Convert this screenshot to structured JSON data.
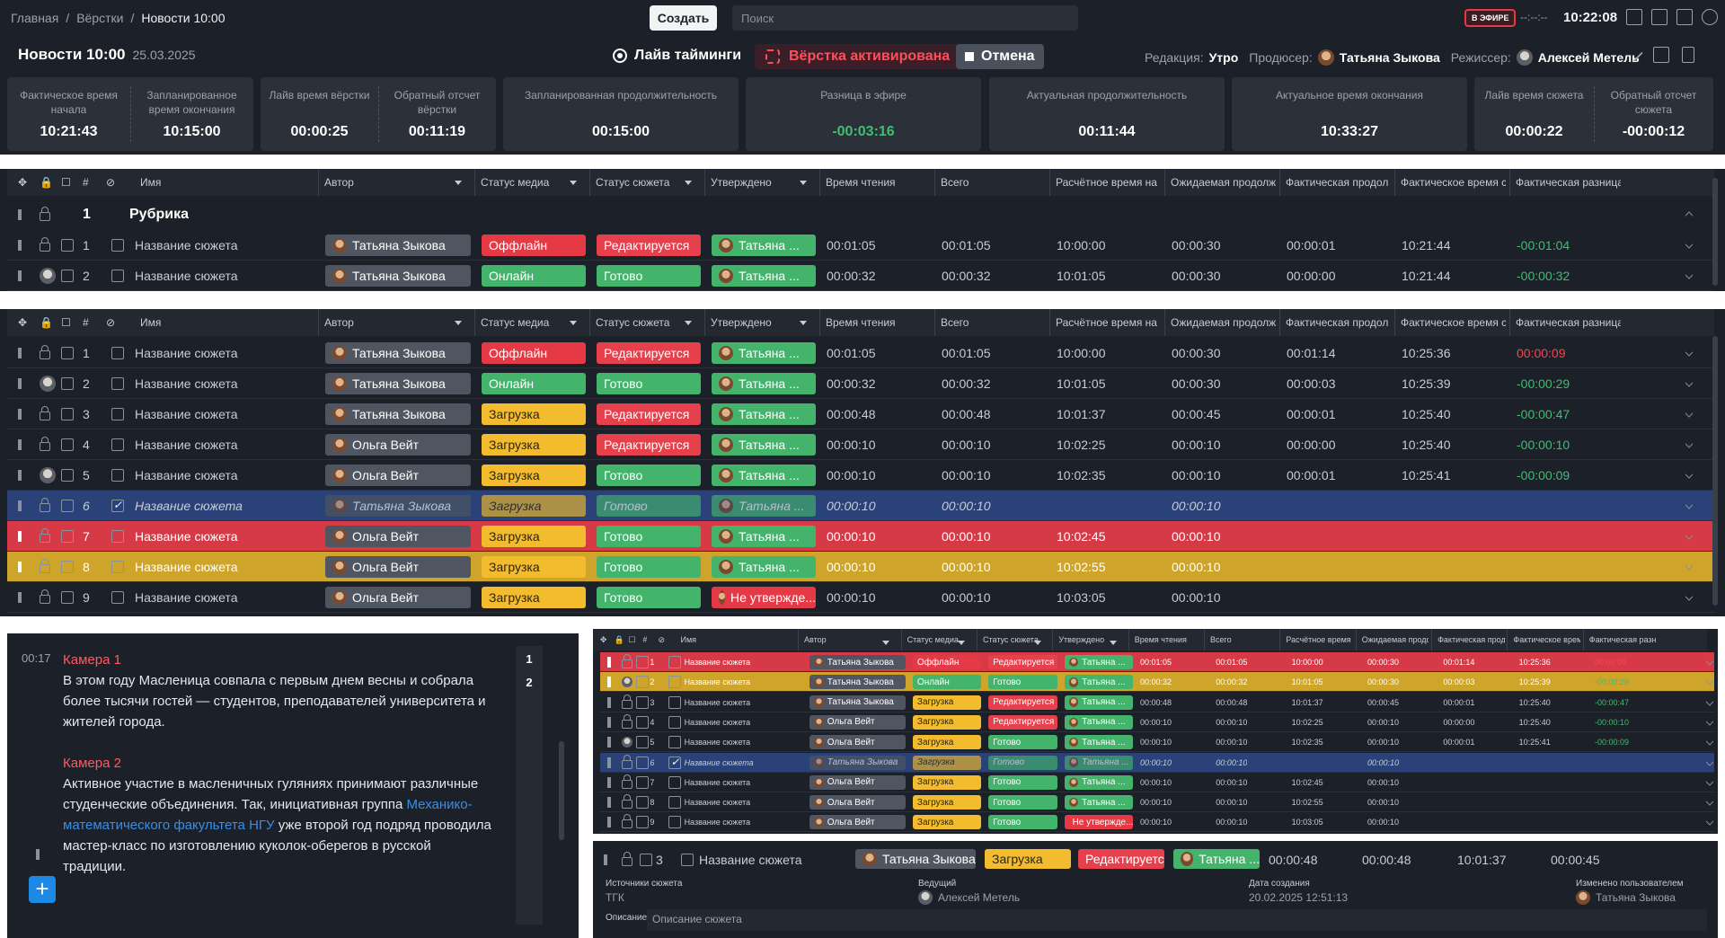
{
  "breadcrumbs": [
    "Главная",
    "Вёрстки",
    "Новости 10:00"
  ],
  "create_label": "Создать",
  "search_placeholder": "Поиск",
  "on_air_badge": "В ЭФИРЕ",
  "air_time": "--:--:--",
  "clock": "10:22:08",
  "rundown": {
    "title": "Новости 10:00",
    "date": "25.03.2025"
  },
  "live_timings_label": "Лайв тайминги",
  "verstka_active_label": "Вёрстка активирована",
  "cancel_label": "Отмена",
  "staff": {
    "redaction_label": "Редакция:",
    "redaction": "Утро",
    "producer_label": "Продюсер:",
    "producer": "Татьяна Зыкова",
    "director_label": "Режиссер:",
    "director": "Алексей Метель"
  },
  "stats": [
    {
      "label": "Фактическое время начала",
      "value": "10:21:43"
    },
    {
      "label": "Запланированное время окончания",
      "value": "10:15:00"
    },
    {
      "label": "Лайв время вёрстки",
      "value": "00:00:25"
    },
    {
      "label": "Обратный отсчет вёрстки",
      "value": "00:11:19"
    },
    {
      "label": "Запланированная продолжительность",
      "value": "00:15:00"
    },
    {
      "label": "Разница в эфире",
      "value": "-00:03:16"
    },
    {
      "label": "Актуальная продолжительность",
      "value": "00:11:44"
    },
    {
      "label": "Актуальное время окончания",
      "value": "10:33:27"
    },
    {
      "label": "Лайв время сюжета",
      "value": "00:00:22"
    },
    {
      "label": "Обратный отсчет сюжета",
      "value": "-00:00:12"
    }
  ],
  "columns": [
    "#",
    "Имя",
    "Автор",
    "Статус медиа",
    "Статус сюжета",
    "Утверждено",
    "Время чтения",
    "Всего",
    "Расчётное время на",
    "Ожидаемая продолж",
    "Фактическая продол",
    "Фактическое время с",
    "Фактическая разница"
  ],
  "rubric": {
    "num": "1",
    "title": "Рубрика"
  },
  "top_rows": [
    {
      "n": "1",
      "name": "Название сюжета",
      "author": "Татьяна Зыкова",
      "media": "Оффлайн",
      "status": "Редактируется",
      "appr": "Татьяна ...",
      "read": "00:01:05",
      "total": "00:01:05",
      "calc": "10:00:00",
      "exp": "00:00:30",
      "fact": "00:00:01",
      "facttime": "10:21:44",
      "diff": "-00:01:04"
    },
    {
      "n": "2",
      "name": "Название сюжета",
      "author": "Татьяна Зыкова",
      "media": "Онлайн",
      "status": "Готово",
      "appr": "Татьяна ...",
      "read": "00:00:32",
      "total": "00:00:32",
      "calc": "10:01:05",
      "exp": "00:00:30",
      "fact": "00:00:00",
      "facttime": "10:21:44",
      "diff": "-00:00:32"
    }
  ],
  "main_rows": [
    {
      "n": "1",
      "name": "Название сюжета",
      "author": "Татьяна Зыкова",
      "media": "Оффлайн",
      "status": "Редактируется",
      "appr": "Татьяна ...",
      "read": "00:01:05",
      "total": "00:01:05",
      "calc": "10:00:00",
      "exp": "00:00:30",
      "fact": "00:01:14",
      "facttime": "10:25:36",
      "diff": "00:00:09"
    },
    {
      "n": "2",
      "name": "Название сюжета",
      "author": "Татьяна Зыкова",
      "media": "Онлайн",
      "status": "Готово",
      "appr": "Татьяна ...",
      "read": "00:00:32",
      "total": "00:00:32",
      "calc": "10:01:05",
      "exp": "00:00:30",
      "fact": "00:00:03",
      "facttime": "10:25:39",
      "diff": "-00:00:29"
    },
    {
      "n": "3",
      "name": "Название сюжета",
      "author": "Татьяна Зыкова",
      "media": "Загрузка",
      "status": "Редактируется",
      "appr": "Татьяна ...",
      "read": "00:00:48",
      "total": "00:00:48",
      "calc": "10:01:37",
      "exp": "00:00:45",
      "fact": "00:00:01",
      "facttime": "10:25:40",
      "diff": "-00:00:47"
    },
    {
      "n": "4",
      "name": "Название сюжета",
      "author": "Ольга Вейт",
      "media": "Загрузка",
      "status": "Редактируется",
      "appr": "Татьяна ...",
      "read": "00:00:10",
      "total": "00:00:10",
      "calc": "10:02:25",
      "exp": "00:00:10",
      "fact": "00:00:00",
      "facttime": "10:25:40",
      "diff": "-00:00:10"
    },
    {
      "n": "5",
      "name": "Название сюжета",
      "author": "Ольга Вейт",
      "media": "Загрузка",
      "status": "Готово",
      "appr": "Татьяна ...",
      "read": "00:00:10",
      "total": "00:00:10",
      "calc": "10:02:35",
      "exp": "00:00:10",
      "fact": "00:00:01",
      "facttime": "10:25:41",
      "diff": "-00:00:09"
    },
    {
      "n": "6",
      "name": "Название сюжета",
      "author": "Татьяна Зыкова",
      "media": "Загрузка",
      "status": "Готово",
      "appr": "Татьяна ...",
      "read": "00:00:10",
      "total": "00:00:10",
      "calc": "",
      "exp": "00:00:10",
      "fact": "",
      "facttime": "",
      "diff": ""
    },
    {
      "n": "7",
      "name": "Название сюжета",
      "author": "Ольга Вейт",
      "media": "Загрузка",
      "status": "Готово",
      "appr": "Татьяна ...",
      "read": "00:00:10",
      "total": "00:00:10",
      "calc": "10:02:45",
      "exp": "00:00:10",
      "fact": "",
      "facttime": "",
      "diff": ""
    },
    {
      "n": "8",
      "name": "Название сюжета",
      "author": "Ольга Вейт",
      "media": "Загрузка",
      "status": "Готово",
      "appr": "Татьяна ...",
      "read": "00:00:10",
      "total": "00:00:10",
      "calc": "10:02:55",
      "exp": "00:00:10",
      "fact": "",
      "facttime": "",
      "diff": ""
    },
    {
      "n": "9",
      "name": "Название сюжета",
      "author": "Ольга Вейт",
      "media": "Загрузка",
      "status": "Готово",
      "appr": "Не утвержде...",
      "read": "00:00:10",
      "total": "00:00:10",
      "calc": "10:03:05",
      "exp": "00:00:10",
      "fact": "",
      "facttime": "",
      "diff": ""
    }
  ],
  "script": {
    "timecode": "00:17",
    "camera1": "Камера 1",
    "para1": "В этом году Масленица совпала с первым днем весны и собрала более тысячи гостей — студентов, преподавателей университета и жителей города.",
    "camera2": "Камера 2",
    "para2_a": "Активное участие в масленичных гуляниях принимают различные студенческие объединения. Так, инициативная группа ",
    "para2_link": "Механико-математического факультета НГУ",
    "para2_b": " уже второй год подряд проводила мастер-класс по изготовлению куколок-оберегов в русской традиции.",
    "nums": [
      "1",
      "2"
    ]
  },
  "detail": {
    "n": "3",
    "name": "Название сюжета",
    "author": "Татьяна Зыкова",
    "media": "Загрузка",
    "status": "Редактируется",
    "appr": "Татьяна ...",
    "read": "00:00:48",
    "total": "00:00:48",
    "calc": "10:01:37",
    "exp": "00:00:45",
    "sources_label": "Источники сюжета",
    "sources": "ТГК",
    "host_label": "Ведущий",
    "host": "Алексей Метель",
    "created_label": "Дата создания",
    "created": "20.02.2025 12:51:13",
    "changed_label": "Изменено пользователем",
    "changed": "Татьяна Зыкова",
    "desc_label": "Описание",
    "desc": "Описание сюжета"
  },
  "colors": {
    "red": "#e53a46",
    "green": "#44b36c",
    "yellow": "#f3bc2e",
    "blue_selected": "#2a4278",
    "background": "#1c2028"
  }
}
